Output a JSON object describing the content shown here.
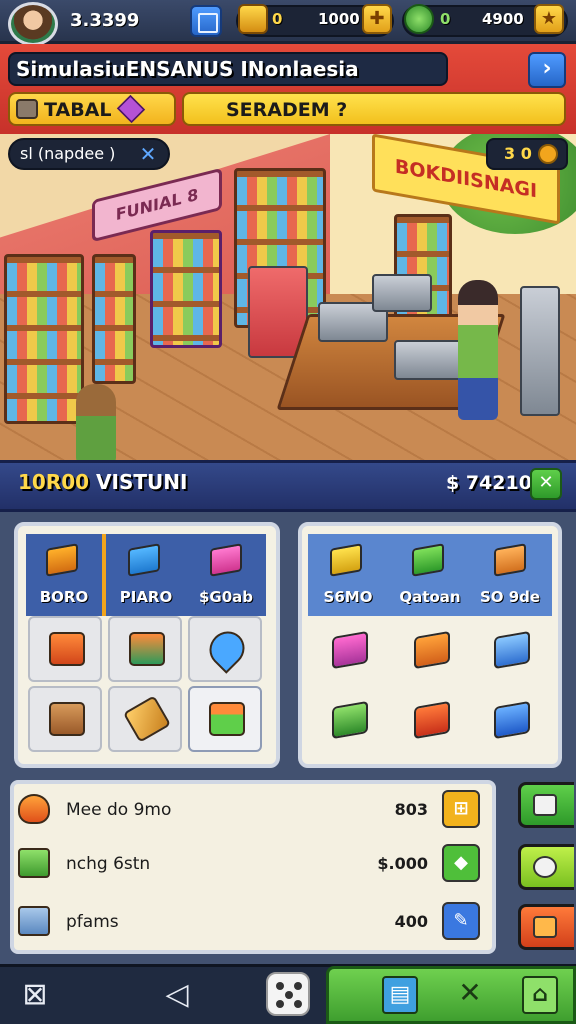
{
  "top_bar": {
    "player_score": "3.3399",
    "resources": [
      {
        "name": "gold",
        "value": "1000",
        "small_value": "0",
        "icon": "gold-bar-icon",
        "color": "#f2b31d"
      },
      {
        "name": "gems",
        "value": "4900",
        "small_value": "0",
        "icon": "leaf-gem-icon",
        "color": "#3fae3a"
      }
    ]
  },
  "header": {
    "title": "SimulasiuENSANUS INonlaesia",
    "tab_left": "TABAL",
    "tab_right": "SERADEM ?"
  },
  "scene": {
    "badge_text": "sl (napdee )",
    "coin_text": "3 0",
    "store_sign": "FUNIAL 8",
    "store_name": "BOKDIISNAGI"
  },
  "status_bar": {
    "visitors_number": "10R00",
    "visitors_label": "VISTUNI",
    "money": "$ 74210"
  },
  "left_panel": {
    "categories": [
      {
        "label": "BORO",
        "icon": "box-icon"
      },
      {
        "label": "PIARO",
        "icon": "cube-icon"
      },
      {
        "label": "$G0ab",
        "icon": "pink-box-icon"
      }
    ],
    "slots": [
      {
        "icon": "cart-icon"
      },
      {
        "icon": "crate-icon"
      },
      {
        "icon": "location-pin-icon"
      },
      {
        "icon": "toolbox-icon"
      },
      {
        "icon": "hammer-icon"
      },
      {
        "icon": "basket-icon"
      }
    ]
  },
  "right_panel": {
    "categories": [
      {
        "label": "S6MO",
        "icon": "yellow-box-icon"
      },
      {
        "label": "Qatoan",
        "icon": "green-basket-icon"
      },
      {
        "label": "SO 9de",
        "icon": "bag-icon"
      }
    ],
    "slots": [
      {
        "icon": "pink-book-icon"
      },
      {
        "icon": "tray-icon"
      },
      {
        "icon": "blue-stack-icon"
      },
      {
        "icon": "green-cube-icon"
      },
      {
        "icon": "red-crate-icon"
      },
      {
        "icon": "blue-box-icon"
      }
    ]
  },
  "list": [
    {
      "label": "Mee do 9mo",
      "value": "803",
      "icon": "fire-icon",
      "btn_color": "#f2b31d"
    },
    {
      "label": "nchg 6stn",
      "value": "$.000",
      "icon": "basket-icon",
      "btn_color": "#4fbf3a"
    },
    {
      "label": "pfams",
      "value": "400",
      "icon": "cooler-icon",
      "btn_color": "#3a78e0"
    }
  ],
  "colors": {
    "accent_red": "#d9574d",
    "accent_yellow": "#f2c01d",
    "panel_blue": "#3d5fa8",
    "nav_green": "#4fb03a"
  }
}
